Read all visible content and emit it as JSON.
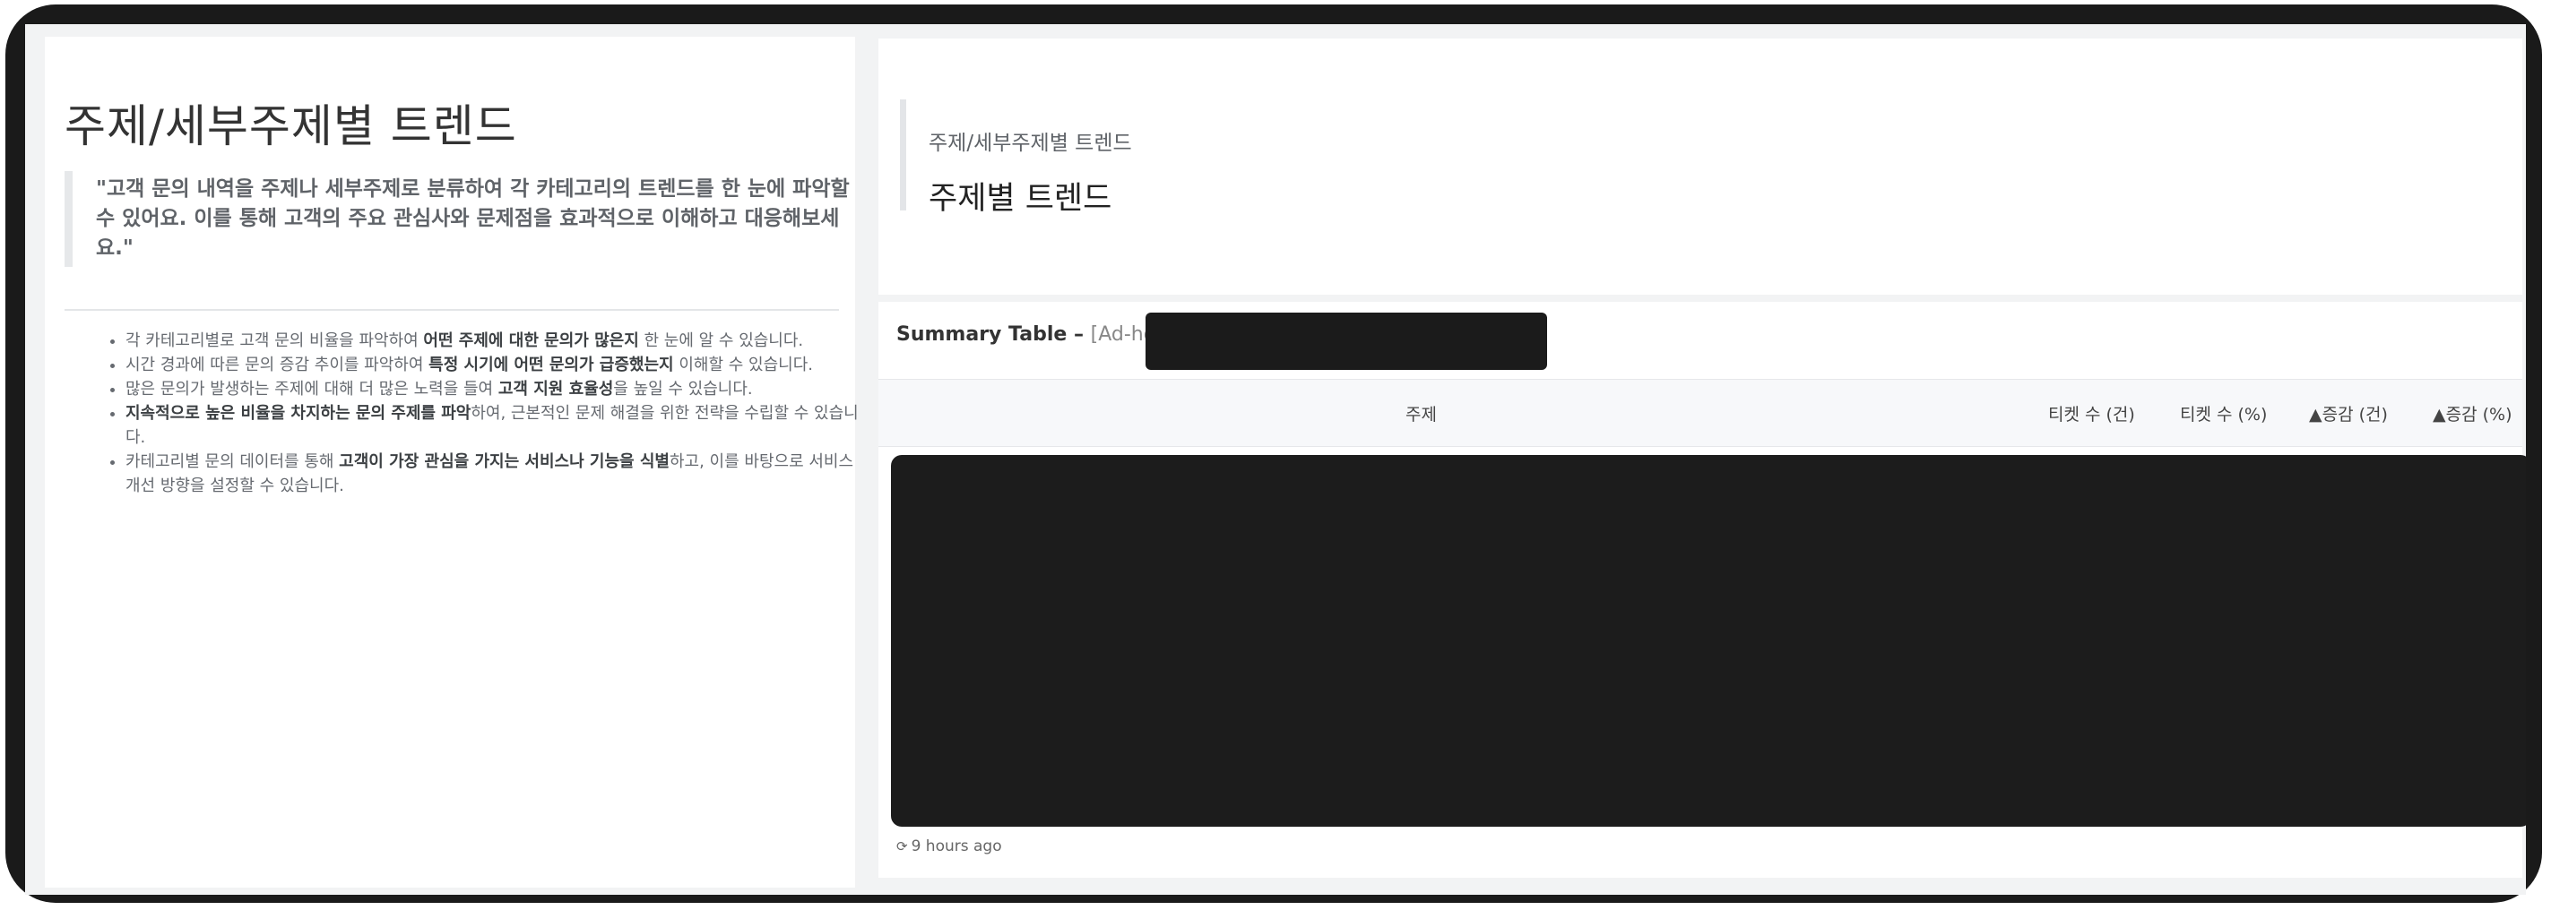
{
  "left": {
    "title": "주제/세부주제별 트렌드",
    "quote": "\"고객 문의 내역을 주제나 세부주제로 분류하여 각 카테고리의 트렌드를 한 눈에 파악할 수 있어요. 이를 통해 고객의 주요 관심사와 문제점을 효과적으로 이해하고 대응해보세요.\"",
    "bullets": [
      {
        "pre": "각 카테고리별로 고객 문의 비율을 파악하여 ",
        "bold": "어떤 주제에 대한 문의가 많은지",
        "post": " 한 눈에 알 수 있습니다."
      },
      {
        "pre": "시간 경과에 따른 문의 증감 추이를 파악하여 ",
        "bold": "특정 시기에 어떤 문의가 급증했는지",
        "post": " 이해할 수 있습니다."
      },
      {
        "pre": "많은 문의가 발생하는 주제에 대해 더 많은 노력을 들여 ",
        "bold": "고객 지원 효율성",
        "post": "을 높일 수 있습니다."
      },
      {
        "pre": "",
        "bold": "지속적으로 높은 비율을 차지하는 문의 주제를 파악",
        "post": "하여, 근본적인 문제 해결을 위한 전략을 수립할 수 있습니다."
      },
      {
        "pre": "카테고리별 문의 데이터를 통해 ",
        "bold": "고객이 가장 관심을 가지는 서비스나 기능을 식별",
        "post": "하고, 이를 바탕으로 서비스 개선 방향을 설정할 수 있습니다."
      }
    ]
  },
  "title_card": {
    "subtitle": "주제/세부주제별 트렌드",
    "title": "주제별 트렌드"
  },
  "table_card": {
    "label": "Summary Table",
    "separator": "–",
    "tag": "[Ad-hoc]",
    "columns": [
      "주제",
      "티켓 수 (건)",
      "티켓 수 (%)",
      "▲증감 (건)",
      "▲증감 (%)"
    ],
    "footer_icon": "refresh-icon",
    "updated": "9 hours ago"
  }
}
